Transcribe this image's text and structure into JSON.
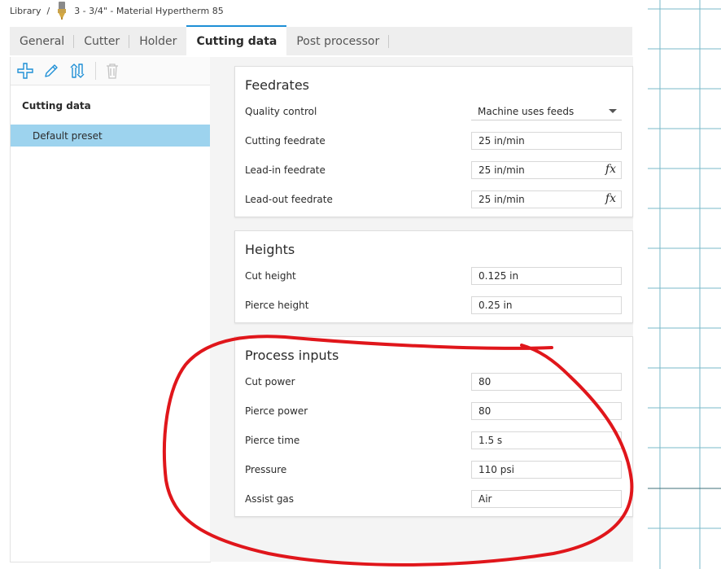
{
  "breadcrumb": {
    "root": "Library",
    "separator": "/",
    "tool_name": "3 - 3/4\" - Material Hypertherm 85"
  },
  "tabs": [
    {
      "label": "General",
      "active": false
    },
    {
      "label": "Cutter",
      "active": false
    },
    {
      "label": "Holder",
      "active": false
    },
    {
      "label": "Cutting data",
      "active": true
    },
    {
      "label": "Post processor",
      "active": false
    }
  ],
  "toolbar": {
    "icons": [
      "add-icon",
      "edit-icon",
      "sort-icon",
      "delete-icon"
    ]
  },
  "left_panel": {
    "section_title": "Cutting data",
    "items": [
      {
        "label": "Default preset",
        "selected": true
      }
    ]
  },
  "feedrates": {
    "title": "Feedrates",
    "rows": [
      {
        "label": "Quality control",
        "value": "Machine uses feeds",
        "type": "select"
      },
      {
        "label": "Cutting feedrate",
        "value": "25 in/min",
        "type": "input"
      },
      {
        "label": "Lead-in feedrate",
        "value": "25 in/min",
        "type": "formula"
      },
      {
        "label": "Lead-out feedrate",
        "value": "25 in/min",
        "type": "formula"
      }
    ],
    "fx_label": "fx"
  },
  "heights": {
    "title": "Heights",
    "rows": [
      {
        "label": "Cut height",
        "value": "0.125 in"
      },
      {
        "label": "Pierce height",
        "value": "0.25 in"
      }
    ]
  },
  "process_inputs": {
    "title": "Process inputs",
    "rows": [
      {
        "label": "Cut power",
        "value": "80"
      },
      {
        "label": "Pierce power",
        "value": "80"
      },
      {
        "label": "Pierce time",
        "value": "1.5 s"
      },
      {
        "label": "Pressure",
        "value": "110 psi"
      },
      {
        "label": "Assist gas",
        "value": "Air"
      }
    ]
  },
  "colors": {
    "accent": "#1e8fd6",
    "selection": "#9dd3ee",
    "annotation": "#e0161b",
    "grid": "#7ab8c9"
  }
}
